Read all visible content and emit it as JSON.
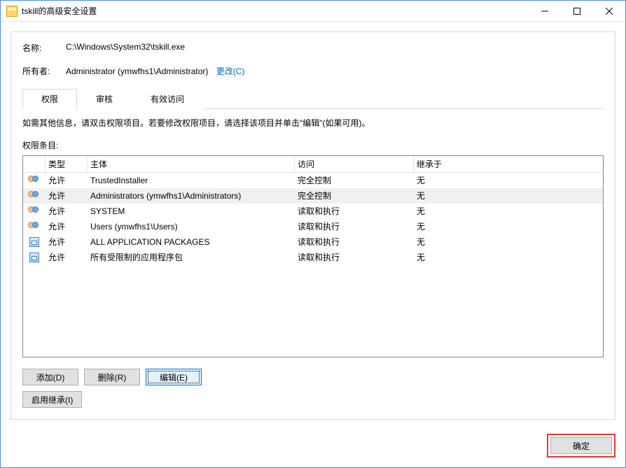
{
  "window": {
    "title": "tskill的高级安全设置"
  },
  "info": {
    "name_label": "名称:",
    "name_value": "C:\\Windows\\System32\\tskill.exe",
    "owner_label": "所有者:",
    "owner_value": "Administrator (ymwfhs1\\Administrator)",
    "change_link": "更改(C)"
  },
  "tabs": {
    "t0": "权限",
    "t1": "审核",
    "t2": "有效访问"
  },
  "instruction": "如需其他信息，请双击权限项目。若要修改权限项目，请选择该项目并单击\"编辑\"(如果可用)。",
  "section_label": "权限条目:",
  "columns": {
    "type": "类型",
    "principal": "主体",
    "access": "访问",
    "inherit": "继承于"
  },
  "rows": [
    {
      "icon": "users",
      "type": "允许",
      "principal": "TrustedInstaller",
      "access": "完全控制",
      "inherit": "无"
    },
    {
      "icon": "users",
      "type": "允许",
      "principal": "Administrators (ymwfhs1\\Administrators)",
      "access": "完全控制",
      "inherit": "无"
    },
    {
      "icon": "users",
      "type": "允许",
      "principal": "SYSTEM",
      "access": "读取和执行",
      "inherit": "无"
    },
    {
      "icon": "users",
      "type": "允许",
      "principal": "Users (ymwfhs1\\Users)",
      "access": "读取和执行",
      "inherit": "无"
    },
    {
      "icon": "store",
      "type": "允许",
      "principal": "ALL APPLICATION PACKAGES",
      "access": "读取和执行",
      "inherit": "无"
    },
    {
      "icon": "store",
      "type": "允许",
      "principal": "所有受限制的应用程序包",
      "access": "读取和执行",
      "inherit": "无"
    }
  ],
  "buttons": {
    "add": "添加(D)",
    "remove": "删除(R)",
    "edit": "编辑(E)",
    "enable_inherit": "启用继承(I)",
    "ok": "确定"
  }
}
